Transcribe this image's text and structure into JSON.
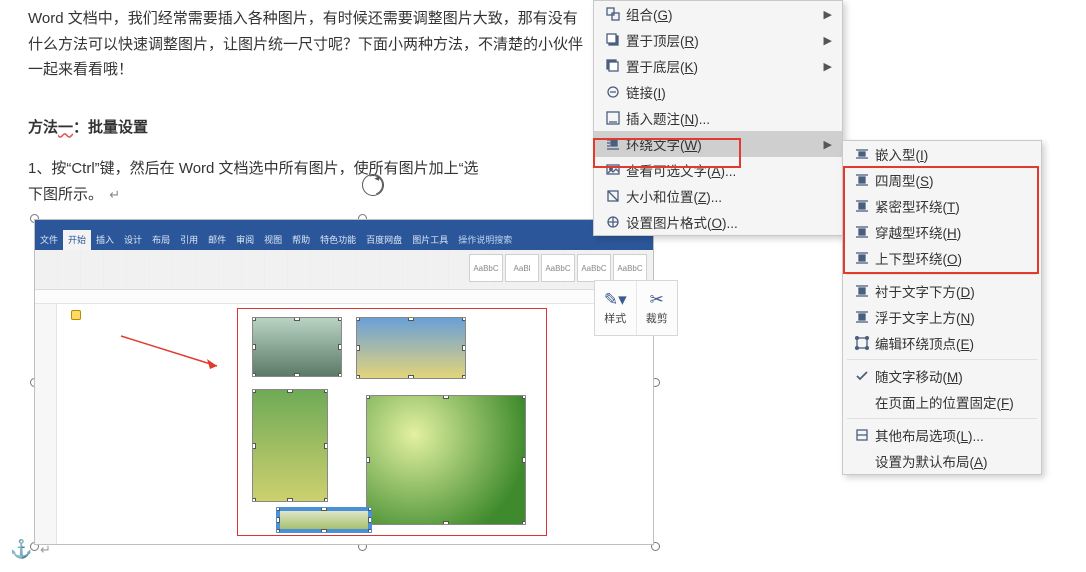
{
  "article": {
    "para1": "Word 文档中，我们经常需要插入各种图片，有时候还需要调整图片大致，那有没有什么方法可以快速调整图片，让图片统一尺寸呢？下面小两种方法，不清楚的小伙伴一起来看看哦！",
    "para2_prefix": "方法",
    "para2_wave": "一",
    "para2_suffix": "：批量设置",
    "para3_a": "1、按“Ctrl”键，然后在 Word 文档选中所有图片，使所有图片加上“选",
    "para3_b": "下图所示。"
  },
  "ribbon": {
    "tabs": [
      "文件",
      "开始",
      "插入",
      "设计",
      "布局",
      "引用",
      "邮件",
      "审阅",
      "视图",
      "帮助",
      "特色功能",
      "百度网盘",
      "图片工具"
    ],
    "tellme": "操作说明搜索",
    "styles": [
      "AaBbC",
      "AaBl",
      "AaBbC",
      "AaBbC",
      "AaBbC"
    ]
  },
  "mini": {
    "style": "样式",
    "crop": "裁剪"
  },
  "menu1": {
    "items": [
      {
        "icon": "group",
        "label": "组合",
        "hot": "G",
        "arrow": true
      },
      {
        "icon": "front",
        "label": "置于顶层",
        "hot": "R",
        "arrow": true
      },
      {
        "icon": "back",
        "label": "置于底层",
        "hot": "K",
        "arrow": true
      },
      {
        "icon": "link",
        "label": "链接",
        "hot": "I",
        "arrow": false
      },
      {
        "icon": "caption",
        "label": "插入题注",
        "hot": "N",
        "suffix": "...",
        "arrow": false
      },
      {
        "icon": "wrap",
        "label": "环绕文字",
        "hot": "W",
        "arrow": true,
        "hl": true
      },
      {
        "icon": "alt",
        "label": "查看可选文字",
        "hot": "A",
        "suffix": "...",
        "arrow": false
      },
      {
        "icon": "size",
        "label": "大小和位置",
        "hot": "Z",
        "suffix": "...",
        "arrow": false
      },
      {
        "icon": "fmt",
        "label": "设置图片格式",
        "hot": "O",
        "suffix": "...",
        "arrow": false
      }
    ]
  },
  "menu2": {
    "items": [
      {
        "icon": "inline",
        "label": "嵌入型",
        "hot": "I"
      },
      {
        "icon": "square",
        "label": "四周型",
        "hot": "S"
      },
      {
        "icon": "tight",
        "label": "紧密型环绕",
        "hot": "T"
      },
      {
        "icon": "through",
        "label": "穿越型环绕",
        "hot": "H"
      },
      {
        "icon": "topbot",
        "label": "上下型环绕",
        "hot": "O"
      },
      {
        "sep": true
      },
      {
        "icon": "behind",
        "label": "衬于文字下方",
        "hot": "D"
      },
      {
        "icon": "infront",
        "label": "浮于文字上方",
        "hot": "N"
      },
      {
        "icon": "editpts",
        "label": "编辑环绕顶点",
        "hot": "E"
      },
      {
        "sep": true
      },
      {
        "icon": "check",
        "label": "随文字移动",
        "hot": "M"
      },
      {
        "icon": "",
        "label": "在页面上的位置固定",
        "hot": "F"
      },
      {
        "sep": true
      },
      {
        "icon": "more",
        "label": "其他布局选项",
        "hot": "L",
        "suffix": "..."
      },
      {
        "icon": "",
        "label": "设置为默认布局",
        "hot": "A"
      }
    ]
  }
}
